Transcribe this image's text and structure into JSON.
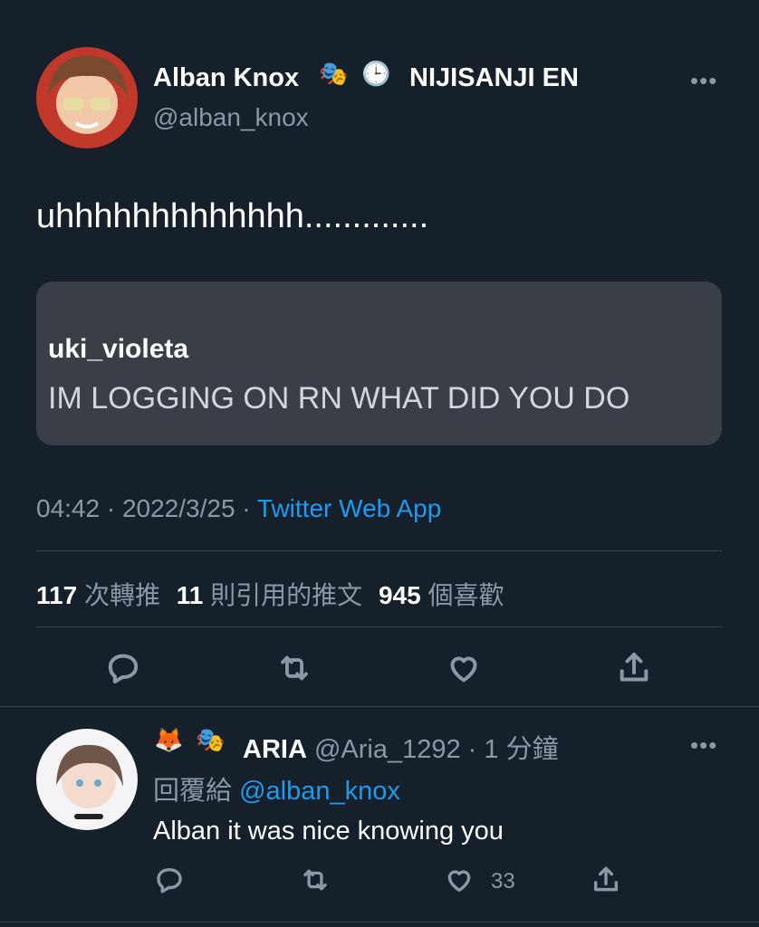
{
  "tweet": {
    "author_name": "Alban Knox",
    "author_badges_text": "NIJISANJI EN",
    "author_handle": "@alban_knox",
    "body": "uhhhhhhhhhhhhh.............",
    "quote": {
      "username": "uki_violeta",
      "text": "IM LOGGING ON RN WHAT DID YOU DO"
    },
    "timestamp": "04:42 · 2022/3/25 · ",
    "source": "Twitter Web App",
    "stats": {
      "retweets_count": "117",
      "retweets_label": "次轉推",
      "quotes_count": "11",
      "quotes_label": "則引用的推文",
      "likes_count": "945",
      "likes_label": "個喜歡"
    },
    "more_label": "•••"
  },
  "reply": {
    "author_name": "ARIA",
    "author_handle": "@Aria_1292",
    "time": "· 1 分鐘",
    "replying_label": "回覆給",
    "replying_to": "@alban_knox",
    "body": "Alban it was nice knowing you",
    "like_count": "33",
    "more_label": "•••"
  },
  "icons": {
    "theater_masks": "🎭",
    "clock": "🕒",
    "fox": "🦊"
  },
  "colors": {
    "background": "#15202b",
    "accent": "#1d9bf0",
    "muted": "#8b98a5",
    "quote_bg": "#3a3f47"
  }
}
